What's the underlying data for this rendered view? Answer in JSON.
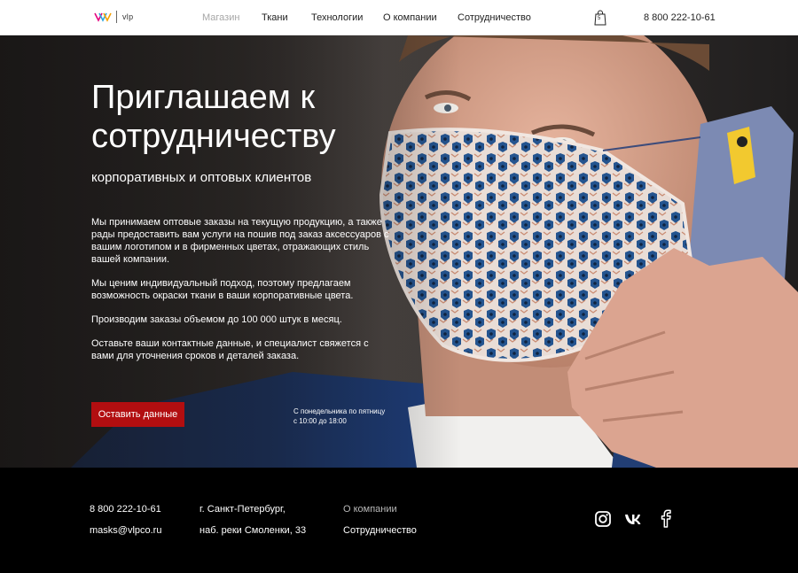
{
  "header": {
    "logo_text": "vlp",
    "nav": [
      {
        "label": "Магазин",
        "active": true
      },
      {
        "label": "Ткани",
        "active": false
      },
      {
        "label": "Технологии",
        "active": false
      },
      {
        "label": "О компании",
        "active": false
      },
      {
        "label": "Сотрудничество",
        "active": false
      }
    ],
    "cart_count": "5",
    "phone": "8 800 222-10-61"
  },
  "hero": {
    "title": "Приглашаем к сотрудничеству",
    "subtitle": "корпоративных и оптовых клиентов",
    "paragraphs": [
      "Мы принимаем оптовые заказы на текущую продукцию, а также рады предоставить вам услуги на пошив под заказ аксессуаров с вашим логотипом и в фирменных цветах, отражающих стиль вашей компании.",
      "Мы ценим индивидуальный подход, поэтому предлагаем возможность окраски ткани в ваши корпоративные цвета.",
      "Производим заказы объемом до 100 000 штук в месяц.",
      "Оставьте ваши контактные данные, и специалист свяжется с вами для уточнения сроков и деталей заказа."
    ],
    "cta_label": "Оставить данные",
    "hours_line1": "С понедельника по пятницу",
    "hours_line2": "с 10:00 до 18:00"
  },
  "footer": {
    "phone": "8 800 222-10-61",
    "email": "masks@vlpco.ru",
    "address_line1": "г. Санкт-Петербург,",
    "address_line2": "наб. реки Смоленки, 33",
    "links": [
      "О компании",
      "Сотрудничество"
    ],
    "social": [
      "instagram-icon",
      "vk-icon",
      "facebook-icon"
    ]
  },
  "colors": {
    "accent": "#b20e10",
    "header_bg": "#ffffff",
    "footer_bg": "#000000",
    "nav_active": "#a7a7a7"
  }
}
